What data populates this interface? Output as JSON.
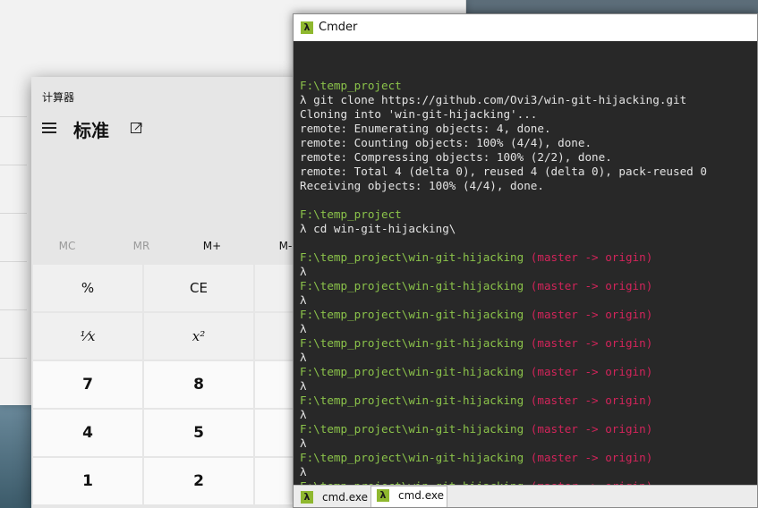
{
  "calculator": {
    "title": "计算器",
    "mode": "标准",
    "memory": [
      "MC",
      "MR",
      "M+",
      "M-"
    ],
    "keys_row1": [
      "%",
      "CE"
    ],
    "keys_row2": [
      "¹⁄x",
      "x²"
    ],
    "keys_row3": [
      "7",
      "8"
    ],
    "keys_row4": [
      "4",
      "5"
    ],
    "keys_row5": [
      "1",
      "2"
    ]
  },
  "cmder": {
    "title": "Cmder",
    "lines": [
      {
        "segments": []
      },
      {
        "segments": [
          {
            "text": "F:\\temp_project",
            "color": "green"
          }
        ]
      },
      {
        "segments": [
          {
            "text": "λ git clone https://github.com/Ovi3/win-git-hijacking.git",
            "color": "white"
          }
        ]
      },
      {
        "segments": [
          {
            "text": "Cloning into 'win-git-hijacking'...",
            "color": "white"
          }
        ]
      },
      {
        "segments": [
          {
            "text": "remote: Enumerating objects: 4, done.",
            "color": "white"
          }
        ]
      },
      {
        "segments": [
          {
            "text": "remote: Counting objects: 100% (4/4), done.",
            "color": "white"
          }
        ]
      },
      {
        "segments": [
          {
            "text": "remote: Compressing objects: 100% (2/2), done.",
            "color": "white"
          }
        ]
      },
      {
        "segments": [
          {
            "text": "remote: Total 4 (delta 0), reused 4 (delta 0), pack-reused 0",
            "color": "white"
          }
        ]
      },
      {
        "segments": [
          {
            "text": "Receiving objects: 100% (4/4), done.",
            "color": "white"
          }
        ]
      },
      {
        "segments": []
      },
      {
        "segments": [
          {
            "text": "F:\\temp_project",
            "color": "green"
          }
        ]
      },
      {
        "segments": [
          {
            "text": "λ cd win-git-hijacking\\",
            "color": "white"
          }
        ]
      },
      {
        "segments": []
      },
      {
        "segments": [
          {
            "text": "F:\\temp_project\\win-git-hijacking ",
            "color": "green"
          },
          {
            "text": "(master -> origin)",
            "color": "pink"
          }
        ]
      },
      {
        "segments": [
          {
            "text": "λ",
            "color": "white"
          }
        ]
      },
      {
        "segments": [
          {
            "text": "F:\\temp_project\\win-git-hijacking ",
            "color": "green"
          },
          {
            "text": "(master -> origin)",
            "color": "pink"
          }
        ]
      },
      {
        "segments": [
          {
            "text": "λ",
            "color": "white"
          }
        ]
      },
      {
        "segments": [
          {
            "text": "F:\\temp_project\\win-git-hijacking ",
            "color": "green"
          },
          {
            "text": "(master -> origin)",
            "color": "pink"
          }
        ]
      },
      {
        "segments": [
          {
            "text": "λ",
            "color": "white"
          }
        ]
      },
      {
        "segments": [
          {
            "text": "F:\\temp_project\\win-git-hijacking ",
            "color": "green"
          },
          {
            "text": "(master -> origin)",
            "color": "pink"
          }
        ]
      },
      {
        "segments": [
          {
            "text": "λ",
            "color": "white"
          }
        ]
      },
      {
        "segments": [
          {
            "text": "F:\\temp_project\\win-git-hijacking ",
            "color": "green"
          },
          {
            "text": "(master -> origin)",
            "color": "pink"
          }
        ]
      },
      {
        "segments": [
          {
            "text": "λ",
            "color": "white"
          }
        ]
      },
      {
        "segments": [
          {
            "text": "F:\\temp_project\\win-git-hijacking ",
            "color": "green"
          },
          {
            "text": "(master -> origin)",
            "color": "pink"
          }
        ]
      },
      {
        "segments": [
          {
            "text": "λ",
            "color": "white"
          }
        ]
      },
      {
        "segments": [
          {
            "text": "F:\\temp_project\\win-git-hijacking ",
            "color": "green"
          },
          {
            "text": "(master -> origin)",
            "color": "pink"
          }
        ]
      },
      {
        "segments": [
          {
            "text": "λ",
            "color": "white"
          }
        ]
      },
      {
        "segments": [
          {
            "text": "F:\\temp_project\\win-git-hijacking ",
            "color": "green"
          },
          {
            "text": "(master -> origin)",
            "color": "pink"
          }
        ]
      },
      {
        "segments": [
          {
            "text": "λ",
            "color": "white"
          }
        ]
      },
      {
        "segments": [
          {
            "text": "F:\\temp_project\\win-git-hijacking ",
            "color": "green"
          },
          {
            "text": "(master -> origin)",
            "color": "pink"
          }
        ]
      }
    ],
    "tabs": [
      {
        "label": "cmd.exe",
        "active": false
      },
      {
        "label": "cmd.exe",
        "active": true
      }
    ],
    "icon_glyph": "λ",
    "colors": {
      "green": "#8bc34a",
      "white": "#e3e3e3",
      "pink": "#d2245a",
      "background": "#282828"
    }
  }
}
